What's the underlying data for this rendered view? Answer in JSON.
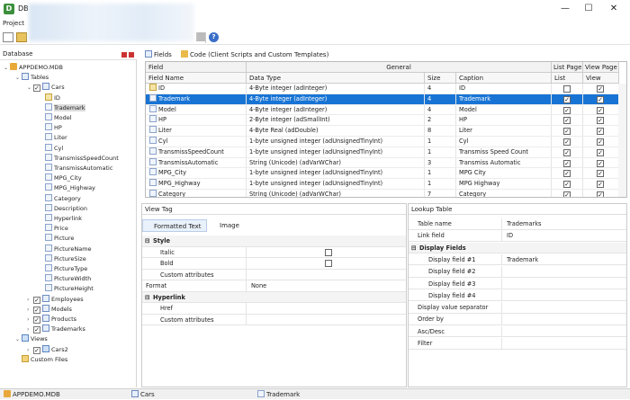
{
  "window": {
    "title": "DB",
    "minimize": "—",
    "maximize": "☐",
    "close": "✕"
  },
  "menu": {
    "project": "Project"
  },
  "left_panel": {
    "title": "Database"
  },
  "tree": [
    {
      "label": "APPDEMO.MDB",
      "icon": "database-icon",
      "level": 0,
      "toggle": "⌄"
    },
    {
      "label": "Tables",
      "icon": "table-icon",
      "level": 1,
      "toggle": "⌄"
    },
    {
      "label": "Cars",
      "icon": "table-icon",
      "level": 2,
      "toggle": "⌄",
      "checked": true
    },
    {
      "label": "ID",
      "icon": "key-field-icon",
      "level": 3
    },
    {
      "label": "Trademark",
      "icon": "field-icon",
      "level": 3,
      "selected": true
    },
    {
      "label": "Model",
      "icon": "field-icon",
      "level": 3
    },
    {
      "label": "HP",
      "icon": "field-icon",
      "level": 3
    },
    {
      "label": "Liter",
      "icon": "field-icon",
      "level": 3
    },
    {
      "label": "Cyl",
      "icon": "field-icon",
      "level": 3
    },
    {
      "label": "TransmissSpeedCount",
      "icon": "field-icon",
      "level": 3
    },
    {
      "label": "TransmissAutomatic",
      "icon": "field-icon",
      "level": 3
    },
    {
      "label": "MPG_City",
      "icon": "field-icon",
      "level": 3
    },
    {
      "label": "MPG_Highway",
      "icon": "field-icon",
      "level": 3
    },
    {
      "label": "Category",
      "icon": "field-icon",
      "level": 3
    },
    {
      "label": "Description",
      "icon": "field-icon",
      "level": 3
    },
    {
      "label": "Hyperlink",
      "icon": "field-icon",
      "level": 3
    },
    {
      "label": "Price",
      "icon": "field-icon",
      "level": 3
    },
    {
      "label": "Picture",
      "icon": "field-icon",
      "level": 3
    },
    {
      "label": "PictureName",
      "icon": "field-icon",
      "level": 3
    },
    {
      "label": "PictureSize",
      "icon": "field-icon",
      "level": 3
    },
    {
      "label": "PictureType",
      "icon": "field-icon",
      "level": 3
    },
    {
      "label": "PictureWidth",
      "icon": "field-icon",
      "level": 3
    },
    {
      "label": "PictureHeight",
      "icon": "field-icon",
      "level": 3
    },
    {
      "label": "Employees",
      "icon": "table-icon",
      "level": 2,
      "toggle": "›",
      "checked": true
    },
    {
      "label": "Models",
      "icon": "table-icon",
      "level": 2,
      "toggle": "›",
      "checked": true
    },
    {
      "label": "Products",
      "icon": "table-icon",
      "level": 2,
      "toggle": "›",
      "checked": true
    },
    {
      "label": "Trademarks",
      "icon": "table-icon",
      "level": 2,
      "toggle": "›",
      "checked": true
    },
    {
      "label": "Views",
      "icon": "view-icon",
      "level": 1,
      "toggle": "⌄"
    },
    {
      "label": "Cars2",
      "icon": "view-icon",
      "level": 2,
      "toggle": "›",
      "checked": true
    },
    {
      "label": "Custom Files",
      "icon": "folder-icon",
      "level": 1
    }
  ],
  "fields_bar": {
    "fields_tab": "Fields",
    "code_tab": "Code (Client Scripts and Custom Templates)"
  },
  "grid": {
    "group_field": "Field",
    "group_general": "General",
    "group_list_page": "List Page",
    "group_view_page": "View Page",
    "headers": {
      "name": "Field Name",
      "type": "Data Type",
      "size": "Size",
      "caption": "Caption",
      "list": "List",
      "view": "View"
    },
    "rows": [
      {
        "name": "ID",
        "type": "4-Byte integer (adInteger)",
        "size": "4",
        "caption": "ID",
        "list": false,
        "view": true,
        "key": true
      },
      {
        "name": "Trademark",
        "type": "4-Byte integer (adInteger)",
        "size": "4",
        "caption": "Trademark",
        "list": true,
        "view": true,
        "selected": true
      },
      {
        "name": "Model",
        "type": "4-Byte integer (adInteger)",
        "size": "4",
        "caption": "Model",
        "list": true,
        "view": true
      },
      {
        "name": "HP",
        "type": "2-Byte integer (adSmallInt)",
        "size": "2",
        "caption": "HP",
        "list": true,
        "view": true
      },
      {
        "name": "Liter",
        "type": "4-Byte Real (adDouble)",
        "size": "8",
        "caption": "Liter",
        "list": true,
        "view": true
      },
      {
        "name": "Cyl",
        "type": "1-byte unsigned integer (adUnsignedTinyInt)",
        "size": "1",
        "caption": "Cyl",
        "list": true,
        "view": true
      },
      {
        "name": "TransmissSpeedCount",
        "type": "1-byte unsigned integer (adUnsignedTinyInt)",
        "size": "1",
        "caption": "Transmiss Speed Count",
        "list": true,
        "view": true
      },
      {
        "name": "TransmissAutomatic",
        "type": "String (Unicode) (adVarWChar)",
        "size": "3",
        "caption": "Transmiss Automatic",
        "list": true,
        "view": true
      },
      {
        "name": "MPG_City",
        "type": "1-byte unsigned integer (adUnsignedTinyInt)",
        "size": "1",
        "caption": "MPG City",
        "list": true,
        "view": true
      },
      {
        "name": "MPG_Highway",
        "type": "1-byte unsigned integer (adUnsignedTinyInt)",
        "size": "1",
        "caption": "MPG Highway",
        "list": true,
        "view": true
      },
      {
        "name": "Category",
        "type": "String (Unicode) (adVarWChar)",
        "size": "7",
        "caption": "Category",
        "list": true,
        "view": true
      }
    ]
  },
  "view_tag": {
    "title": "View Tag",
    "tab_formatted": "Formatted Text",
    "tab_image": "Image",
    "props": [
      {
        "label": "Style",
        "category": true
      },
      {
        "label": "Italic",
        "checkbox": true
      },
      {
        "label": "Bold",
        "checkbox": true
      },
      {
        "label": "Custom attributes",
        "value": ""
      },
      {
        "label": "Format",
        "value": "None",
        "top": true
      },
      {
        "label": "Hyperlink",
        "category": true
      },
      {
        "label": "Href",
        "value": ""
      },
      {
        "label": "Custom attributes",
        "value": ""
      }
    ]
  },
  "lookup": {
    "title": "Lookup Table",
    "props": [
      {
        "label": "Table name",
        "value": "Trademarks"
      },
      {
        "label": "Link field",
        "value": "ID"
      },
      {
        "label": "Display Fields",
        "category": true
      },
      {
        "label": "Display field #1",
        "value": "Trademark"
      },
      {
        "label": "Display field #2",
        "value": ""
      },
      {
        "label": "Display field #3",
        "value": ""
      },
      {
        "label": "Display field #4",
        "value": ""
      },
      {
        "label": "Display value separator",
        "value": ""
      },
      {
        "label": "Order by",
        "value": ""
      },
      {
        "label": "Asc/Desc",
        "value": ""
      },
      {
        "label": "Filter",
        "value": ""
      }
    ]
  },
  "status": {
    "db": "APPDEMO.MDB",
    "table": "Cars",
    "field": "Trademark"
  }
}
